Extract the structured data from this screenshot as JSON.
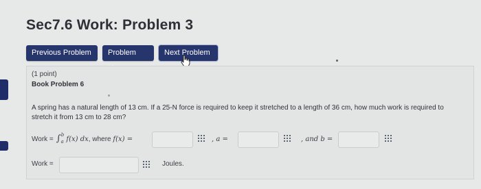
{
  "page": {
    "title": "Sec7.6 Work: Problem 3"
  },
  "nav": {
    "previous": "Previous Problem",
    "list": "Problem List",
    "next": "Next Problem"
  },
  "problem": {
    "points": "(1 point)",
    "book": "Book Problem 6",
    "text": "A spring has a natural length of 13 cm. If a 25-N force is required to keep it stretched to a length of 36 cm, how much work is required to stretch it from 13 cm to 28 cm?"
  },
  "row1": {
    "work_label": "Work = ",
    "integral": "∫",
    "lower": "a",
    "upper": "b",
    "integrand": "f(x) dx",
    "where": ", where ",
    "f_of_x": "f(x) =",
    "comma_a": ", a =",
    "and_b": ", and b =",
    "fx_value": "",
    "a_value": "",
    "b_value": ""
  },
  "row2": {
    "work_label": "Work =",
    "work_value": "",
    "units": "Joules."
  },
  "colors": {
    "nav_button": "#27356d",
    "left_tab": "#1f2e68"
  }
}
